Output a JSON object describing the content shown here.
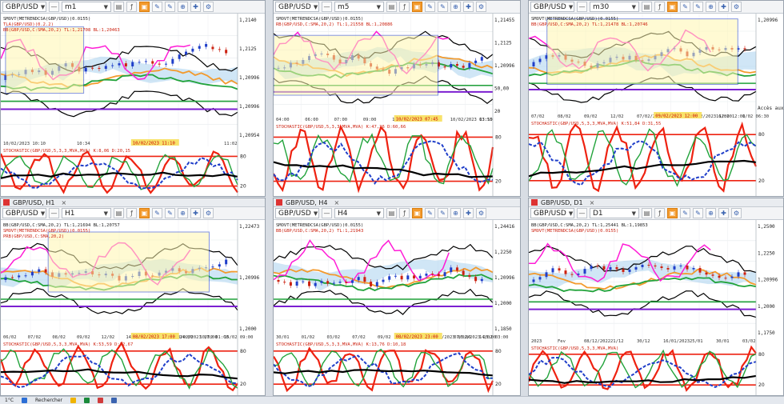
{
  "panels": [
    {
      "id": "p1",
      "symbol": "GBP/USD",
      "timeframe": "m1",
      "tab": "",
      "indicators": [
        "SMOVT(METRENDCSA(GBP/USD)(0.0155)",
        "TLA(GBP/USD)(0.2.2)",
        "BB(GBP/USD,C:SMA,20,2) TL:1,21708 BL:1,20463"
      ],
      "stoch": "STOCHASTIC(GBP/USD,5,3,3,MVA,MVA) K:8,06 D:20,15",
      "prices": [
        "1,2140",
        "1,2125",
        "1,20996",
        "1,20996",
        "1,20954"
      ],
      "axis": [
        "10/02/2023 10:10",
        "10:34",
        "10:46",
        "11:02"
      ],
      "highlight": "10/02/2023 11:10"
    },
    {
      "id": "p2",
      "symbol": "GBP/USD",
      "timeframe": "m5",
      "tab": "",
      "indicators": [
        "SMOVT(METRENDCSA(GBP/USD)(0.0155)",
        "RB(GBP/USD,C:SMA,20,2) TL:1,21558 BL:1,20886"
      ],
      "stoch": "STOCHASTIC(GBP/USD,5,3,3,MVA,MVA) K:47,26 D:60,66",
      "prices": [
        "1,21455",
        "1,2125",
        "1,20996",
        "50,00",
        "20"
      ],
      "axis": [
        "04:00",
        "06:00",
        "07:00",
        "09:00",
        "11:00",
        "12:00",
        "10/02/2023 03:10",
        "13:55"
      ],
      "highlight": "10/02/2023 07:45"
    },
    {
      "id": "p3",
      "symbol": "GBP/USD",
      "timeframe": "m30",
      "tab": "",
      "indicators": [
        "SMOVT(METRENDCSA(GBP/USD)(0.0155)",
        "BB(GBP/USD,C:SMA,20,2) TL:1,21478 BL:1,20746"
      ],
      "stoch": "STOCHASTIC(GBP/USD,5,3,3,MVA,MVA) K:51,84 D:31,55",
      "prices": [
        "1,20996",
        "Accès aux ordres"
      ],
      "axis": [
        "07/02",
        "08/02",
        "09/02",
        "12/02",
        "07/02/2023 17:00",
        "23:00",
        "09/02/2023 12:00",
        "16/02 12:00",
        "1/02 06:30"
      ],
      "highlight": "09/02/2023 12:00"
    },
    {
      "id": "p4",
      "symbol": "GBP/USD",
      "timeframe": "H1",
      "tab": "GBP/USD, H1",
      "indicators": [
        "BB(GBP/USD,C:SMA,20,2) TL:1,21694 BL:1,20757",
        "SMOVT(METRENDCSA(GBP/USD)(0.0155)",
        "PRB(GBP/USD,C:SMA,20,2)"
      ],
      "stoch": "STOCHASTIC(GBP/USD,5,3,3,MVA,MVA) K:53,59 D:72,67",
      "prices": [
        "1,22473",
        "1,20996",
        "1,2000"
      ],
      "axis": [
        "06/02",
        "07/02",
        "08/02",
        "09/02",
        "12/02",
        "14/02",
        "10/02/2023 14:00",
        "08/02/2023 17:00",
        "10/02 01:00",
        "15/02 09:00"
      ],
      "highlight": "08/02/2023 17:00"
    },
    {
      "id": "p5",
      "symbol": "GBP/USD",
      "timeframe": "H4",
      "tab": "GBP/USD, H4",
      "indicators": [
        "SMOVT(METRENDCSA(GBP/USD)(0.0155)",
        "BB(GBP/USD,C:SMA,20,2) TL:1,21943"
      ],
      "stoch": "STOCHASTIC(GBP/USD,5,3,3,MVA,MVA) K:13,76 D:10,18",
      "prices": [
        "1,24416",
        "1,2250",
        "1,20996",
        "1,2000",
        "1,1850"
      ],
      "axis": [
        "30/01",
        "01/02",
        "03/02",
        "07/02",
        "09/02",
        "13/02",
        "01/02/2023 03:00",
        "07/02/2023 23:00",
        "14/02 03:00"
      ],
      "highlight": "08/02/2023 23:00"
    },
    {
      "id": "p6",
      "symbol": "GBP/USD",
      "timeframe": "D1",
      "tab": "GBP/USD, D1",
      "indicators": [
        "BB(GBP/USD,C:SMA,20,2) TL:1,25441 BL:1,19853",
        "SMOVT(METRENDCSA(GBP/USD)(0.0155)"
      ],
      "stoch": "STOCHASTIC(GBP/USD,5,3,3,MVA,MVA)",
      "prices": [
        "1,2500",
        "1,2250",
        "1,20996",
        "1,2000",
        "1,1750"
      ],
      "axis": [
        "2023",
        "Fev",
        "08/12/2022",
        "21/12",
        "30/12",
        "16/01/2023",
        "25/01",
        "30/01",
        "03/02"
      ],
      "highlight": ""
    }
  ],
  "taskbar": {
    "items": [
      "1°C",
      "Rechercher"
    ]
  },
  "colors": {
    "orange": "#f39a2d",
    "purple": "#7b1fd1",
    "red": "#e21",
    "green": "#22a33b",
    "blue": "#1f3ec9",
    "magenta": "#ff1cd6",
    "cloud": "#a9d1ee"
  }
}
